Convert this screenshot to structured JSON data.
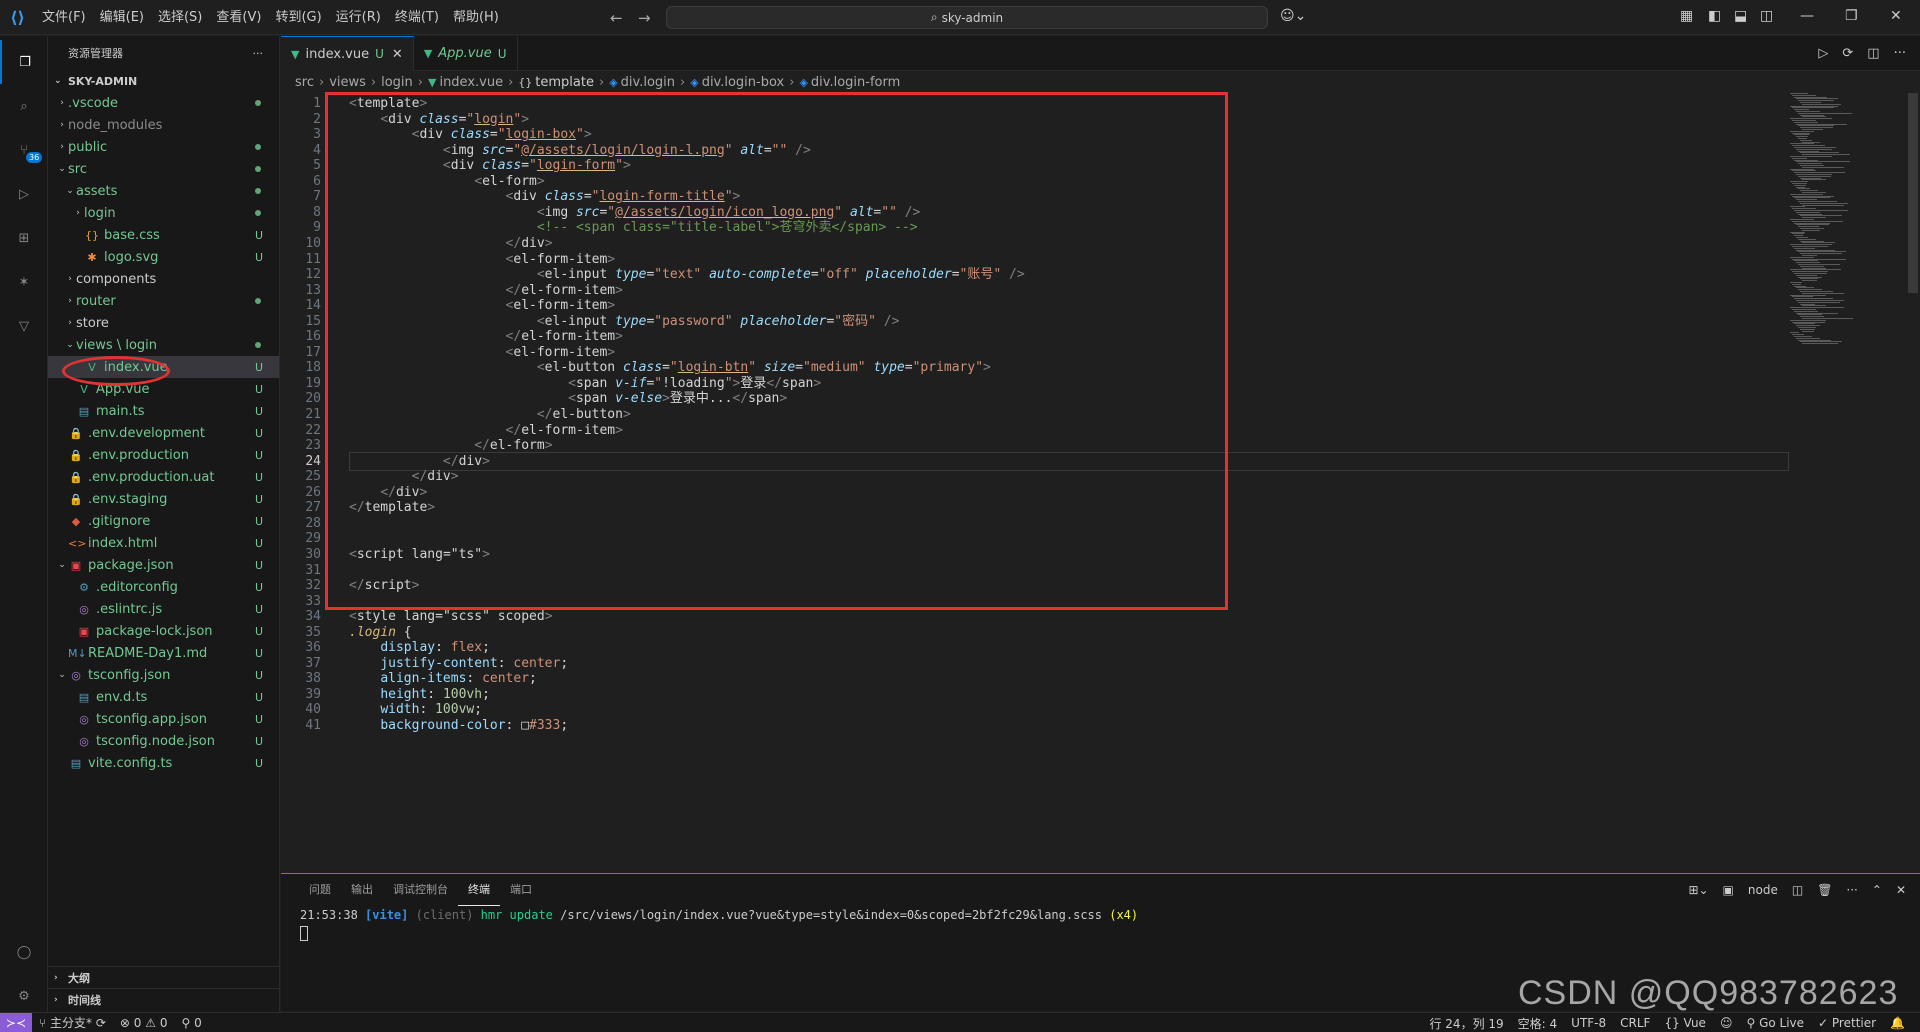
{
  "titlebar": {
    "menu": [
      "文件(F)",
      "编辑(E)",
      "选择(S)",
      "查看(V)",
      "转到(G)",
      "运行(R)",
      "终端(T)",
      "帮助(H)"
    ],
    "search": "sky-admin"
  },
  "activity": {
    "scm_badge": "36"
  },
  "sidebar": {
    "title": "资源管理器",
    "more": "···",
    "root": "SKY-ADMIN",
    "tree": [
      {
        "name": ".vscode",
        "indent": 1,
        "chev": "›",
        "icon": "",
        "status": "dot",
        "color": "c-green"
      },
      {
        "name": "node_modules",
        "indent": 1,
        "chev": "›",
        "icon": "",
        "status": "",
        "color": "c-gray"
      },
      {
        "name": "public",
        "indent": 1,
        "chev": "›",
        "icon": "",
        "status": "dot",
        "color": "c-green"
      },
      {
        "name": "src",
        "indent": 1,
        "chev": "⌄",
        "icon": "",
        "status": "dot",
        "color": "c-green"
      },
      {
        "name": "assets",
        "indent": 2,
        "chev": "⌄",
        "icon": "",
        "status": "dot",
        "color": "c-green"
      },
      {
        "name": "login",
        "indent": 3,
        "chev": "›",
        "icon": "",
        "status": "dot",
        "color": "c-green"
      },
      {
        "name": "base.css",
        "indent": 3,
        "chev": "",
        "icon": "{}",
        "status": "U",
        "color": "c-green"
      },
      {
        "name": "logo.svg",
        "indent": 3,
        "chev": "",
        "icon": "✱",
        "status": "U",
        "color": "c-green"
      },
      {
        "name": "components",
        "indent": 2,
        "chev": "›",
        "icon": "",
        "status": "",
        "color": "c-white"
      },
      {
        "name": "router",
        "indent": 2,
        "chev": "›",
        "icon": "",
        "status": "dot",
        "color": "c-green"
      },
      {
        "name": "store",
        "indent": 2,
        "chev": "›",
        "icon": "",
        "status": "",
        "color": "c-white"
      },
      {
        "name": "views \\ login",
        "indent": 2,
        "chev": "⌄",
        "icon": "",
        "status": "dot",
        "color": "c-green"
      },
      {
        "name": "index.vue",
        "indent": 3,
        "chev": "",
        "icon": "V",
        "status": "U",
        "color": "c-green",
        "selected": true
      },
      {
        "name": "App.vue",
        "indent": 2,
        "chev": "",
        "icon": "V",
        "status": "U",
        "color": "c-green"
      },
      {
        "name": "main.ts",
        "indent": 2,
        "chev": "",
        "icon": "▤",
        "status": "U",
        "color": "c-green"
      },
      {
        "name": ".env.development",
        "indent": 1,
        "chev": "",
        "icon": "🔒",
        "status": "U",
        "color": "c-green"
      },
      {
        "name": ".env.production",
        "indent": 1,
        "chev": "",
        "icon": "🔒",
        "status": "U",
        "color": "c-green"
      },
      {
        "name": ".env.production.uat",
        "indent": 1,
        "chev": "",
        "icon": "🔒",
        "status": "U",
        "color": "c-green"
      },
      {
        "name": ".env.staging",
        "indent": 1,
        "chev": "",
        "icon": "🔒",
        "status": "U",
        "color": "c-green"
      },
      {
        "name": ".gitignore",
        "indent": 1,
        "chev": "",
        "icon": "◆",
        "status": "U",
        "color": "c-green"
      },
      {
        "name": "index.html",
        "indent": 1,
        "chev": "",
        "icon": "<>",
        "status": "U",
        "color": "c-green"
      },
      {
        "name": "package.json",
        "indent": 1,
        "chev": "⌄",
        "icon": "▣",
        "status": "U",
        "color": "c-green"
      },
      {
        "name": ".editorconfig",
        "indent": 2,
        "chev": "",
        "icon": "⚙",
        "status": "U",
        "color": "c-green"
      },
      {
        "name": ".eslintrc.js",
        "indent": 2,
        "chev": "",
        "icon": "◎",
        "status": "U",
        "color": "c-green"
      },
      {
        "name": "package-lock.json",
        "indent": 2,
        "chev": "",
        "icon": "▣",
        "status": "U",
        "color": "c-green"
      },
      {
        "name": "README-Day1.md",
        "indent": 1,
        "chev": "",
        "icon": "M↓",
        "status": "U",
        "color": "c-green"
      },
      {
        "name": "tsconfig.json",
        "indent": 1,
        "chev": "⌄",
        "icon": "◎",
        "status": "U",
        "color": "c-green"
      },
      {
        "name": "env.d.ts",
        "indent": 2,
        "chev": "",
        "icon": "▤",
        "status": "U",
        "color": "c-green"
      },
      {
        "name": "tsconfig.app.json",
        "indent": 2,
        "chev": "",
        "icon": "◎",
        "status": "U",
        "color": "c-green"
      },
      {
        "name": "tsconfig.node.json",
        "indent": 2,
        "chev": "",
        "icon": "◎",
        "status": "U",
        "color": "c-green"
      },
      {
        "name": "vite.config.ts",
        "indent": 1,
        "chev": "",
        "icon": "▤",
        "status": "U",
        "color": "c-green"
      }
    ],
    "outline": "大纲",
    "timeline": "时间线"
  },
  "tabs": [
    {
      "name": "index.vue",
      "flag": "U",
      "active": true
    },
    {
      "name": "App.vue",
      "flag": "U",
      "active": false
    }
  ],
  "breadcrumb": [
    "src",
    "views",
    "login",
    "index.vue",
    "template",
    "div.login",
    "div.login-box",
    "div.login-form"
  ],
  "code": [
    {
      "n": "1",
      "html": "<span class='ang'>&lt;</span><span class='txt'>template</span><span class='ang'>&gt;</span>"
    },
    {
      "n": "2",
      "html": "    <span class='ang'>&lt;</span><span class='txt'>div</span> <span class='attr'>class</span><span class='txt'>=</span><span class='str'>\"<span class='underline'>login</span>\"</span><span class='ang'>&gt;</span>"
    },
    {
      "n": "3",
      "html": "        <span class='ang'>&lt;</span><span class='txt'>div</span> <span class='attr'>class</span><span class='txt'>=</span><span class='str'>\"<span class='underline'>login-box</span>\"</span><span class='ang'>&gt;</span>"
    },
    {
      "n": "4",
      "html": "            <span class='ang'>&lt;</span><span class='txt'>img</span> <span class='attr'>src</span><span class='txt'>=</span><span class='str'>\"<span class='underline'>@/assets/login/login-l.png</span>\"</span> <span class='attr'>alt</span><span class='txt'>=</span><span class='str'>\"\"</span> <span class='ang'>/&gt;</span>"
    },
    {
      "n": "5",
      "html": "            <span class='ang'>&lt;</span><span class='txt'>div</span> <span class='attr'>class</span><span class='txt'>=</span><span class='str'>\"<span class='underline'>login-form</span>\"</span><span class='ang'>&gt;</span>"
    },
    {
      "n": "6",
      "html": "                <span class='ang'>&lt;</span><span class='txt'>el-form</span><span class='ang'>&gt;</span>"
    },
    {
      "n": "7",
      "html": "                    <span class='ang'>&lt;</span><span class='txt'>div</span> <span class='attr'>class</span><span class='txt'>=</span><span class='str'>\"<span class='underline'>login-form-title</span>\"</span><span class='ang'>&gt;</span>"
    },
    {
      "n": "8",
      "html": "                        <span class='ang'>&lt;</span><span class='txt'>img</span> <span class='attr'>src</span><span class='txt'>=</span><span class='str'>\"<span class='underline'>@/assets/login/icon_logo.png</span>\"</span> <span class='attr'>alt</span><span class='txt'>=</span><span class='str'>\"\"</span> <span class='ang'>/&gt;</span>"
    },
    {
      "n": "9",
      "html": "                        <span class='cmt'>&lt;!-- &lt;span class=\"title-label\"&gt;苍穹外卖&lt;/span&gt; --&gt;</span>"
    },
    {
      "n": "10",
      "html": "                    <span class='ang'>&lt;/</span><span class='txt'>div</span><span class='ang'>&gt;</span>"
    },
    {
      "n": "11",
      "html": "                    <span class='ang'>&lt;</span><span class='txt'>el-form-item</span><span class='ang'>&gt;</span>"
    },
    {
      "n": "12",
      "html": "                        <span class='ang'>&lt;</span><span class='txt'>el-input</span> <span class='attr'>type</span><span class='txt'>=</span><span class='str'>\"text\"</span> <span class='attr'>auto-complete</span><span class='txt'>=</span><span class='str'>\"off\"</span> <span class='attr'>placeholder</span><span class='txt'>=</span><span class='str'>\"账号\"</span> <span class='ang'>/&gt;</span>"
    },
    {
      "n": "13",
      "html": "                    <span class='ang'>&lt;/</span><span class='txt'>el-form-item</span><span class='ang'>&gt;</span>"
    },
    {
      "n": "14",
      "html": "                    <span class='ang'>&lt;</span><span class='txt'>el-form-item</span><span class='ang'>&gt;</span>"
    },
    {
      "n": "15",
      "html": "                        <span class='ang'>&lt;</span><span class='txt'>el-input</span> <span class='attr'>type</span><span class='txt'>=</span><span class='str'>\"password\"</span> <span class='attr'>placeholder</span><span class='txt'>=</span><span class='str'>\"密码\"</span> <span class='ang'>/&gt;</span>"
    },
    {
      "n": "16",
      "html": "                    <span class='ang'>&lt;/</span><span class='txt'>el-form-item</span><span class='ang'>&gt;</span>"
    },
    {
      "n": "17",
      "html": "                    <span class='ang'>&lt;</span><span class='txt'>el-form-item</span><span class='ang'>&gt;</span>"
    },
    {
      "n": "18",
      "html": "                        <span class='ang'>&lt;</span><span class='txt'>el-button</span> <span class='attr'>class</span><span class='txt'>=</span><span class='str'>\"<span class='underline'>login-btn</span>\"</span> <span class='attr'>size</span><span class='txt'>=</span><span class='str'>\"medium\"</span> <span class='attr'>type</span><span class='txt'>=</span><span class='str'>\"primary\"</span><span class='ang'>&gt;</span>"
    },
    {
      "n": "19",
      "html": "                            <span class='ang'>&lt;</span><span class='txt'>span</span> <span class='attr'>v-if</span><span class='txt'>=</span><span class='str'>\"<span class='txt'>!loading</span>\"</span><span class='ang'>&gt;</span><span class='txt'>登录</span><span class='ang'>&lt;/</span><span class='txt'>span</span><span class='ang'>&gt;</span>"
    },
    {
      "n": "20",
      "html": "                            <span class='ang'>&lt;</span><span class='txt'>span</span> <span class='attr'>v-else</span><span class='ang'>&gt;</span><span class='txt'>登录中...</span><span class='ang'>&lt;/</span><span class='txt'>span</span><span class='ang'>&gt;</span>"
    },
    {
      "n": "21",
      "html": "                        <span class='ang'>&lt;/</span><span class='txt'>el-button</span><span class='ang'>&gt;</span>"
    },
    {
      "n": "22",
      "html": "                    <span class='ang'>&lt;/</span><span class='txt'>el-form-item</span><span class='ang'>&gt;</span>"
    },
    {
      "n": "23",
      "html": "                <span class='ang'>&lt;/</span><span class='txt'>el-form</span><span class='ang'>&gt;</span>"
    },
    {
      "n": "24",
      "html": "            <span class='ang'>&lt;/</span><span class='txt'>div</span><span class='ang'>&gt;</span>",
      "current": true
    },
    {
      "n": "25",
      "html": "        <span class='ang'>&lt;/</span><span class='txt'>div</span><span class='ang'>&gt;</span>"
    },
    {
      "n": "26",
      "html": "    <span class='ang'>&lt;/</span><span class='txt'>div</span><span class='ang'>&gt;</span>"
    },
    {
      "n": "27",
      "html": "<span class='ang'>&lt;/</span><span class='txt'>template</span><span class='ang'>&gt;</span>"
    },
    {
      "n": "28",
      "html": ""
    },
    {
      "n": "29",
      "html": ""
    },
    {
      "n": "30",
      "html": "<span class='ang'>&lt;</span><span class='txt'>script</span> <span class='txt'>lang</span><span class='txt'>=</span><span class='txt'>\"ts\"</span><span class='ang'>&gt;</span>"
    },
    {
      "n": "31",
      "html": ""
    },
    {
      "n": "32",
      "html": "<span class='ang'>&lt;/</span><span class='txt'>script</span><span class='ang'>&gt;</span>"
    },
    {
      "n": "33",
      "html": ""
    },
    {
      "n": "34",
      "html": "<span class='ang'>&lt;</span><span class='txt'>style</span> <span class='txt'>lang</span><span class='txt'>=</span><span class='txt'>\"scss\"</span> <span class='txt'>scoped</span><span class='ang'>&gt;</span>"
    },
    {
      "n": "35",
      "html": "<span class='sel'>.login</span> <span class='txt'>{</span>"
    },
    {
      "n": "36",
      "html": "    <span class='prop'>display</span><span class='txt'>: </span><span class='val'>flex</span><span class='txt'>;</span>"
    },
    {
      "n": "37",
      "html": "    <span class='prop'>justify-content</span><span class='txt'>: </span><span class='val'>center</span><span class='txt'>;</span>"
    },
    {
      "n": "38",
      "html": "    <span class='prop'>align-items</span><span class='txt'>: </span><span class='val'>center</span><span class='txt'>;</span>"
    },
    {
      "n": "39",
      "html": "    <span class='prop'>height</span><span class='txt'>: </span><span class='num'>100vh</span><span class='txt'>;</span>"
    },
    {
      "n": "40",
      "html": "    <span class='prop'>width</span><span class='txt'>: </span><span class='num'>100vw</span><span class='txt'>;</span>"
    },
    {
      "n": "41",
      "html": "    <span class='prop'>background-color</span><span class='txt'>: </span><span class='txt'>□</span><span class='val'>#333</span><span class='txt'>;</span>"
    }
  ],
  "panel": {
    "tabs": [
      "问题",
      "输出",
      "调试控制台",
      "终端",
      "端口"
    ],
    "active_tab": "终端",
    "terminal_name": "node",
    "log": {
      "time": "21:53:38",
      "tag": "[vite]",
      "client": "(client)",
      "hmr": "hmr update",
      "path": "/src/views/login/index.vue?vue&type=style&index=0&scoped=2bf2fc29&lang.scss",
      "count": "(x4)"
    }
  },
  "watermark": "CSDN @QQ983782623",
  "statusbar": {
    "branch": "主分支*",
    "errors": "0",
    "warnings": "0",
    "ports": "0",
    "position": "行 24，列 19",
    "spaces": "空格: 4",
    "encoding": "UTF-8",
    "eol": "CRLF",
    "language": "Vue",
    "golive": "Go Live",
    "prettier": "Prettier"
  },
  "colors": {
    "accent": "#0078d4",
    "untracked": "#73c991",
    "annotation": "#e33232",
    "panel_border": "#8a5cd8"
  }
}
